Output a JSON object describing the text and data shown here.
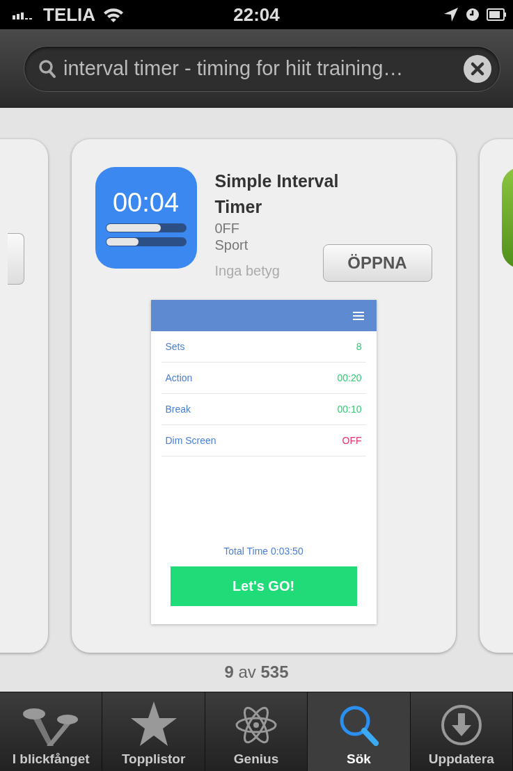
{
  "status_bar": {
    "carrier": "TELIA",
    "time": "22:04"
  },
  "search": {
    "value": "interval timer - timing for hiit training…"
  },
  "app": {
    "icon_time": "00:04",
    "title": "Simple Interval Timer",
    "price": "0FF",
    "category": "Sport",
    "rating": "Inga betyg",
    "button": "ÖPPNA"
  },
  "screenshot": {
    "rows": [
      {
        "label": "Sets",
        "value": "8",
        "color": "#2ecc71"
      },
      {
        "label": "Action",
        "value": "00:20",
        "color": "#2ecc71"
      },
      {
        "label": "Break",
        "value": "00:10",
        "color": "#2ecc71"
      },
      {
        "label": "Dim Screen",
        "value": "OFF",
        "color": "#e8336b"
      }
    ],
    "total": "Total Time 0:03:50",
    "go_button": "Let's GO!"
  },
  "pager": "**9** av **535**",
  "tabs": [
    {
      "label": "I blickfånget",
      "kind": "featured",
      "selected": false
    },
    {
      "label": "Topplistor",
      "kind": "charts",
      "selected": false
    },
    {
      "label": "Genius",
      "kind": "genius",
      "selected": false
    },
    {
      "label": "Sök",
      "kind": "search",
      "selected": true
    },
    {
      "label": "Uppdatera",
      "kind": "updates",
      "selected": false
    }
  ]
}
